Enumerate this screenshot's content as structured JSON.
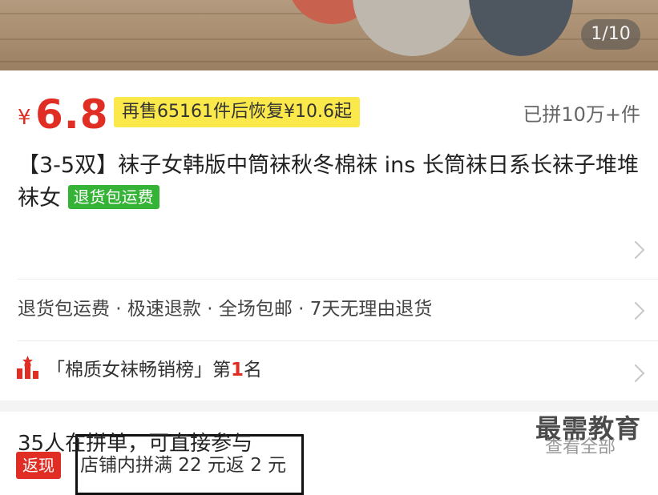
{
  "gallery": {
    "pager": "1/10"
  },
  "price": {
    "currency": "¥",
    "amount": "6.8",
    "promo": "再售65161件后恢复¥10.6起",
    "sold": "已拼10万+件"
  },
  "product": {
    "title": "【3-5双】袜子女韩版中筒袜秋冬棉袜 ins 长筒袜日系长袜子堆堆袜女",
    "tag": "退货包运费"
  },
  "cashback": {
    "badge": "返现",
    "text": "店铺内拼满 22 元返 2 元"
  },
  "services": {
    "text": "退货包运费 · 极速退款 · 全场包邮 · 7天无理由退货"
  },
  "ranking": {
    "prefix": "「棉质女袜畅销榜」第",
    "number": "1",
    "suffix": "名"
  },
  "group_buy": {
    "text": "35人在拼单，可直接参与",
    "view_all": "查看全部"
  },
  "watermark": "最需教育",
  "colors": {
    "accent": "#e02e24",
    "promo_bg": "#fbe84a",
    "green_tag": "#35b336"
  },
  "icons": {
    "ranking": "ranking-bars-icon",
    "chevron": "chevron-right-icon"
  }
}
